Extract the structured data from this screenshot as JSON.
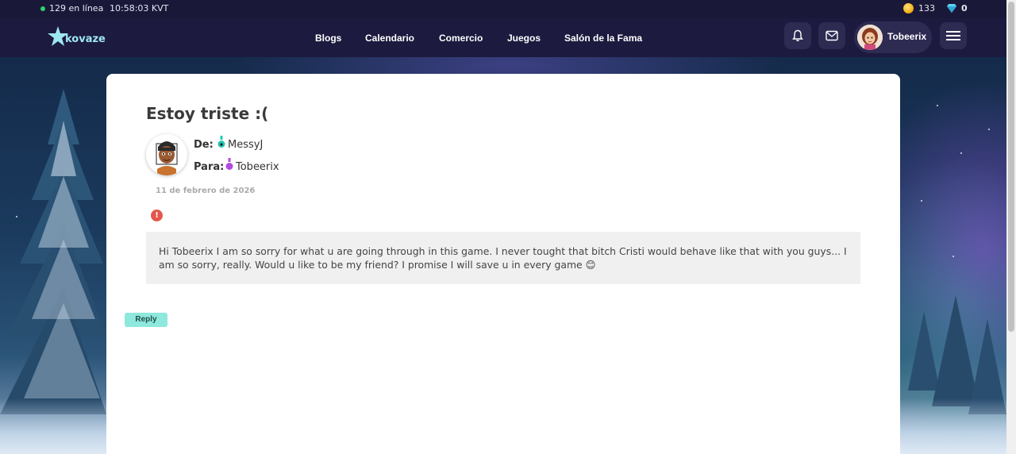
{
  "statusbar": {
    "online": "129 en línea",
    "clock": "10:58:03 KVT",
    "coins": "133",
    "gems": "0"
  },
  "nav": {
    "logo": "kovaze",
    "links": [
      "Blogs",
      "Calendario",
      "Comercio",
      "Juegos",
      "Salón de la Fama"
    ],
    "username": "Tobeerix",
    "icons": [
      "bell-icon",
      "mail-icon",
      "menu-icon"
    ]
  },
  "message": {
    "title": "Estoy triste :(",
    "from_label": "De:",
    "from_name": "MessyJ",
    "to_label": "Para:",
    "to_name": "Tobeerix",
    "date": "11 de febrero de 2026",
    "body": "Hi Tobeerix I am so sorry for what u are going through in this game. I never tought that bitch Cristi would behave like that with you guys... I am so sorry, really. Would u like to be my friend? I promise I will save u in every game 😊",
    "reply_label": "Reply",
    "alert_glyph": "!"
  },
  "colors": {
    "accent": "#8ee8dd",
    "nav_bg": "#1c1a3e",
    "alert": "#e2574c",
    "from_flask": "#22c9b4",
    "to_flask": "#b04be0"
  }
}
